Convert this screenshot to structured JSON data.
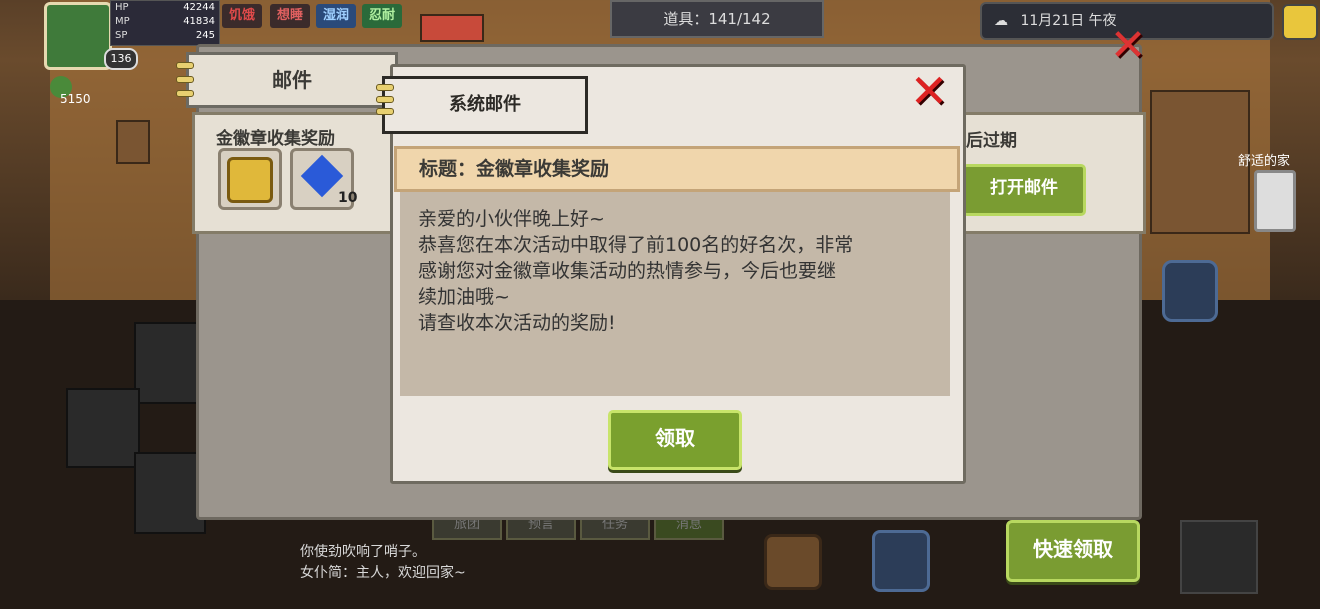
{
  "hud": {
    "hp_label": "HP",
    "hp_value": "42244",
    "mp_label": "MP",
    "mp_value": "41834",
    "sp_label": "SP",
    "sp_value": "245",
    "level": "136",
    "currency": "5150",
    "buffs": [
      "饥饿",
      "想睡",
      "湿润",
      "忍耐"
    ],
    "items": "道具：141/142",
    "date": "11月21日 午夜",
    "location": "舒适的家"
  },
  "mail_window": {
    "tab_label": "邮件",
    "row_title": "金徽章收集奖励",
    "reward_count": "10",
    "expire_text": "后过期",
    "open_button": "打开邮件"
  },
  "dialog": {
    "tab_label": "系统邮件",
    "title": "标题：金徽章收集奖励",
    "body_lines": [
      "亲爱的小伙伴晚上好~",
      "恭喜您在本次活动中取得了前100名的好名次，非常",
      "感谢您对金徽章收集活动的热情参与，今后也要继",
      "续加油哦~",
      "请查收本次活动的奖励!"
    ],
    "claim_button": "领取"
  },
  "bottom": {
    "tabs": [
      "旅团",
      "预言",
      "任务",
      "消息"
    ],
    "chat": [
      "你使劲吹响了哨子。",
      "女仆简：主人，欢迎回家~"
    ],
    "quick_claim": "快速领取"
  }
}
